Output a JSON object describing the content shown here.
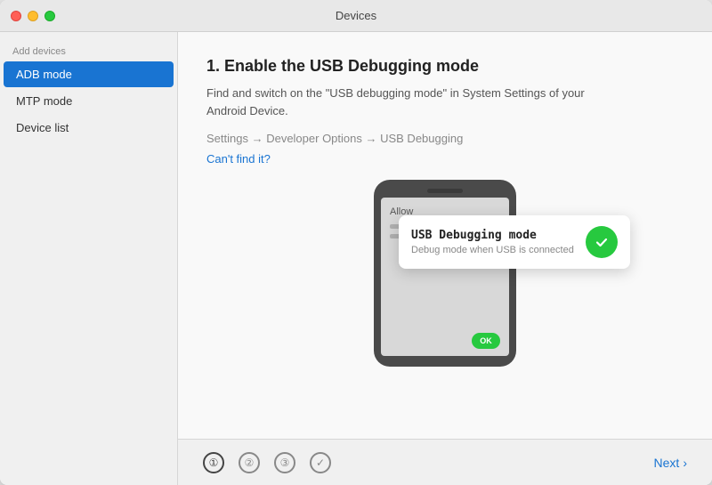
{
  "window": {
    "title": "Devices"
  },
  "sidebar": {
    "section_label": "Add devices",
    "items": [
      {
        "id": "adb-mode",
        "label": "ADB mode",
        "active": true
      },
      {
        "id": "mtp-mode",
        "label": "MTP mode",
        "active": false
      },
      {
        "id": "device-list",
        "label": "Device list",
        "active": false
      }
    ]
  },
  "content": {
    "step_number": "1.",
    "step_title": "1. Enable the USB Debugging mode",
    "step_description": "Find and switch on the \"USB debugging mode\" in System Settings of your Android Device.",
    "settings_path": "Settings → Developer Options → USB Debugging",
    "cant_find_label": "Can't find it?",
    "phone": {
      "allow_text": "Allow",
      "ok_label": "OK"
    },
    "usb_popup": {
      "title": "USB Debugging mode",
      "subtitle": "Debug mode when USB is connected"
    }
  },
  "footer": {
    "indicators": [
      {
        "label": "①",
        "type": "number",
        "value": "1"
      },
      {
        "label": "②",
        "type": "number",
        "value": "2"
      },
      {
        "label": "③",
        "type": "number",
        "value": "3"
      },
      {
        "label": "✓",
        "type": "check"
      }
    ],
    "next_label": "Next",
    "next_chevron": "›"
  },
  "colors": {
    "accent": "#1974d2",
    "active_sidebar": "#1974d2",
    "green": "#27c93f"
  }
}
